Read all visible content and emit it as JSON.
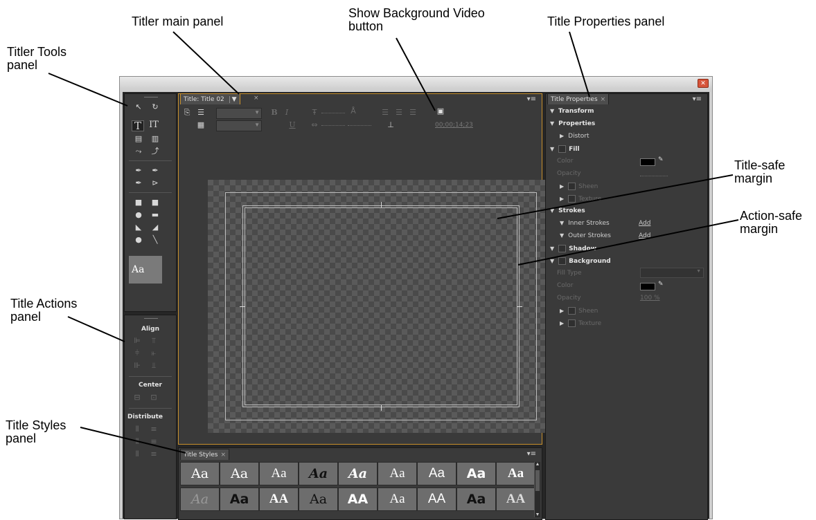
{
  "callouts": {
    "titler_main": "Titler main panel",
    "show_bg_video": "Show Background Video button",
    "title_properties": "Title Properties panel",
    "titler_tools": "Titler Tools panel",
    "title_safe": "Title-safe margin",
    "action_safe": "Action-safe margin",
    "title_actions": "Title Actions panel",
    "title_styles": "Title Styles panel"
  },
  "main_panel": {
    "tab_label": "Title: Title 02",
    "tab_dropdown": "▼",
    "timecode": "00;00;14;23",
    "bold": "B",
    "italic": "I",
    "underline": "U"
  },
  "tools": {
    "type_tool": "T",
    "vertical_type_tool": "IT",
    "style_preview": "Aa"
  },
  "actions": {
    "align": "Align",
    "center": "Center",
    "distribute": "Distribute"
  },
  "properties": {
    "tab_label": "Title Properties",
    "transform": "Transform",
    "properties": "Properties",
    "distort": "Distort",
    "fill": "Fill",
    "color": "Color",
    "opacity": "Opacity",
    "sheen": "Sheen",
    "texture": "Texture",
    "strokes": "Strokes",
    "inner_strokes": "Inner Strokes",
    "outer_strokes": "Outer Strokes",
    "add": "Add",
    "shadow": "Shadow",
    "background": "Background",
    "fill_type": "Fill Type",
    "bg_color": "Color",
    "bg_opacity": "Opacity",
    "bg_opacity_value": "100 %",
    "bg_sheen": "Sheen",
    "bg_texture": "Texture"
  },
  "styles_panel": {
    "tab_label": "Title Styles",
    "row1": [
      "Aa",
      "Aa",
      "Aa",
      "Aa",
      "Aa",
      "Aa",
      "Aa",
      "Aa",
      "Aa"
    ],
    "row2": [
      "Aa",
      "Aa",
      "AA",
      "Aa",
      "AA",
      "Aa",
      "AA",
      "Aa",
      "AA"
    ]
  },
  "colors": {
    "panel_bg": "#3a3a3a",
    "active_border": "#c8902c",
    "safe_margin_line": "#bdbdbd"
  }
}
